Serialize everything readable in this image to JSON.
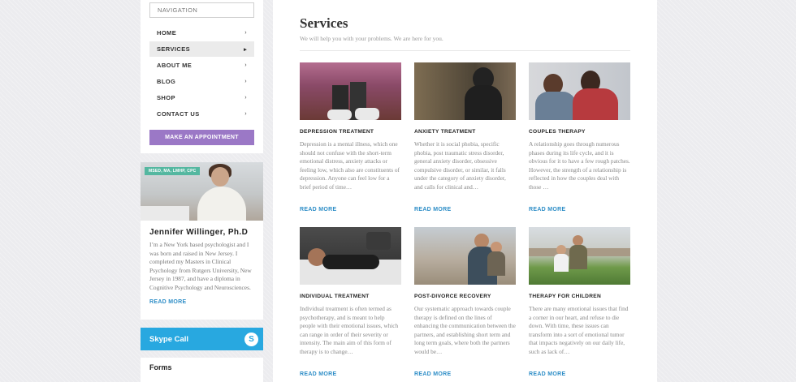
{
  "sidebar": {
    "search_placeholder": "NAVIGATION",
    "nav": [
      {
        "label": "HOME",
        "active": false
      },
      {
        "label": "SERVICES",
        "active": true
      },
      {
        "label": "ABOUT ME",
        "active": false
      },
      {
        "label": "BLOG",
        "active": false
      },
      {
        "label": "SHOP",
        "active": false
      },
      {
        "label": "CONTACT US",
        "active": false
      }
    ],
    "appointment_label": "MAKE AN APPOINTMENT",
    "profile": {
      "badge": "MSED, MA, LMHP, CPC",
      "name": "Jennifer Willinger, Ph.D",
      "text": "I’m a New York based psychologist and I was born and raised in New Jersey. I completed my Masters in Clinical Psychology from Rutgers University, New Jersey in 1987, and have a diploma in Cognitive Psychology and Neurosciences.",
      "read_more": "READ MORE"
    },
    "skype": {
      "label": "Skype Call",
      "icon_letter": "S"
    },
    "forms_label": "Forms"
  },
  "main": {
    "title": "Services",
    "subtitle": "We will help you with your problems. We are here for you.",
    "services": [
      {
        "title": "DEPRESSION TREATMENT",
        "text": "Depression is a mental illness, which one should not confuse with the short-term emotional distress, anxiety attacks or feeling low, which also are constituents of depression. Anyone can feel low for a brief period of time…",
        "read_more": "READ MORE",
        "image": "depression"
      },
      {
        "title": "ANXIETY TREATMENT",
        "text": "Whether it is social phobia, specific phobia, post traumatic stress disorder, general anxiety disorder, obsessive compulsive disorder, or similar, it falls under the category of anxiety disorder, and calls for clinical and…",
        "read_more": "READ MORE",
        "image": "anxiety"
      },
      {
        "title": "COUPLES THERAPY",
        "text": "A relationship goes through numerous phases during its life cycle, and it is obvious for it to have a few rough patches. However, the strength of a relationship is reflected in how the couples deal with those …",
        "read_more": "READ MORE",
        "image": "couples"
      },
      {
        "title": "INDIVIDUAL TREATMENT",
        "text": "Individual treatment is often termed as psychotherapy, and is meant to help people with their emotional issues, which can range in order of their severity or intensity. The main aim of this form of therapy is to change…",
        "read_more": "READ MORE",
        "image": "individual"
      },
      {
        "title": "POST-DIVORCE RECOVERY",
        "text": "Our systematic approach towards couple therapy is defined on the lines of enhancing the communication between the partners, and establishing short term and long term goals, where both the partners would be…",
        "read_more": "READ MORE",
        "image": "divorce"
      },
      {
        "title": "THERAPY FOR CHILDREN",
        "text": "There are many emotional issues that find a corner in our heart, and refuse to die down. With time, these issues can transform into a sort of emotional tumor that impacts negatively on our daily life, such as lack of…",
        "read_more": "READ MORE",
        "image": "children"
      }
    ]
  },
  "colors": {
    "accent_purple": "#9b78c6",
    "link_blue": "#2e8ec7",
    "skype_blue": "#28a8e0",
    "badge_green": "#54b7a0"
  }
}
